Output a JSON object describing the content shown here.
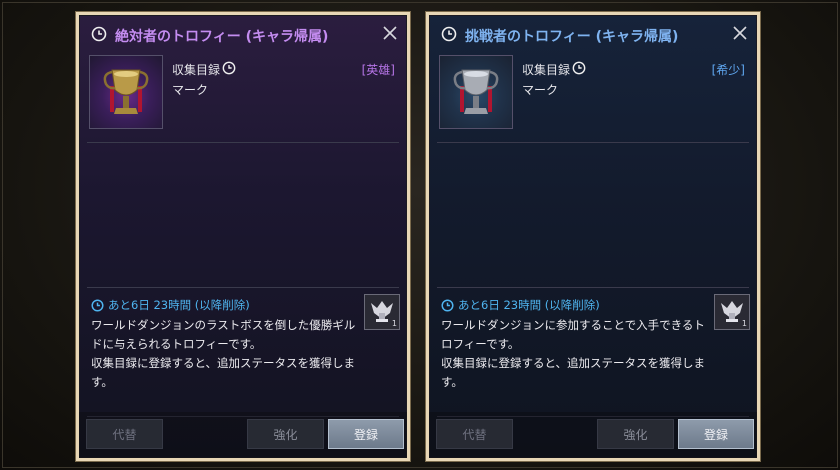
{
  "cards": [
    {
      "title": "絶対者のトロフィー (キャラ帰属)",
      "category": "収集目録",
      "subcategory": "マーク",
      "rarity": "[英雄]",
      "expire": "あと6日 23時間 (以降削除)",
      "description": "ワールドダンジョンのラストボスを倒した優勝ギルドに与えられるトロフィーです。\n収集目録に登録すると、追加ステータスを獲得します。",
      "badge_count": "1",
      "buttons": {
        "alt": "代替",
        "enhance": "強化",
        "register": "登録"
      },
      "accent_color": "#c48cf0"
    },
    {
      "title": "挑戦者のトロフィー (キャラ帰属)",
      "category": "収集目録",
      "subcategory": "マーク",
      "rarity": "[希少]",
      "expire": "あと6日 23時間 (以降削除)",
      "description": "ワールドダンジョンに参加することで入手できるトロフィーです。\n収集目録に登録すると、追加ステータスを獲得します。",
      "badge_count": "1",
      "buttons": {
        "alt": "代替",
        "enhance": "強化",
        "register": "登録"
      },
      "accent_color": "#7fb3f0"
    }
  ],
  "icons": {
    "title": "clock-icon",
    "close": "close-icon",
    "item": "trophy-icon",
    "expire": "clock-icon",
    "badge": "helmet-icon"
  }
}
